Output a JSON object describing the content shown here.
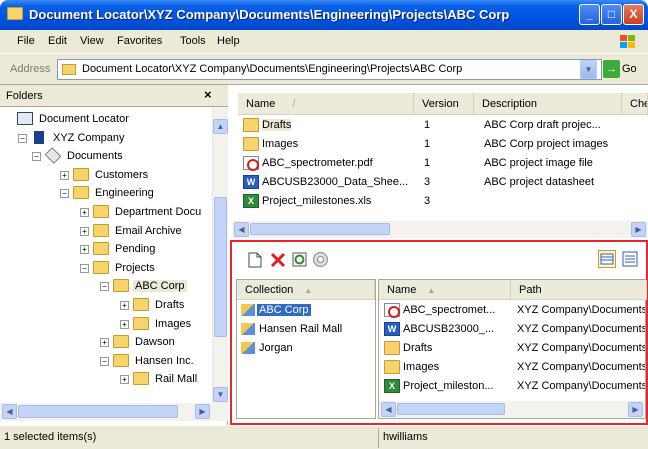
{
  "window": {
    "title": "Document Locator\\XYZ Company\\Documents\\Engineering\\Projects\\ABC Corp",
    "minimize": "_",
    "maximize": "□",
    "close": "X"
  },
  "menu": [
    "File",
    "Edit",
    "View",
    "Favorites",
    "Tools",
    "Help"
  ],
  "address": {
    "label": "Address",
    "value": "Document Locator\\XYZ Company\\Documents\\Engineering\\Projects\\ABC Corp",
    "go_label": "Go"
  },
  "folders": {
    "title": "Folders",
    "close": "×",
    "tree": [
      {
        "label": "Document Locator",
        "expander": "",
        "icon": "network-icon",
        "selected": false
      },
      {
        "label": "XYZ Company",
        "expander": "−",
        "icon": "company-icon",
        "selected": false
      },
      {
        "label": "Documents",
        "expander": "−",
        "icon": "documents-icon",
        "selected": false
      },
      {
        "label": "Customers",
        "expander": "+",
        "icon": "folder-icon",
        "selected": false
      },
      {
        "label": "Engineering",
        "expander": "−",
        "icon": "folder-icon",
        "selected": false
      },
      {
        "label": "Department Docu",
        "expander": "+",
        "icon": "folder-icon",
        "selected": false
      },
      {
        "label": "Email Archive",
        "expander": "+",
        "icon": "folder-icon",
        "selected": false
      },
      {
        "label": "Pending",
        "expander": "+",
        "icon": "folder-icon",
        "selected": false
      },
      {
        "label": "Projects",
        "expander": "−",
        "icon": "folder-icon",
        "selected": false
      },
      {
        "label": "ABC Corp",
        "expander": "−",
        "icon": "folder-open-icon",
        "selected": true
      },
      {
        "label": "Drafts",
        "expander": "+",
        "icon": "folder-icon",
        "selected": false
      },
      {
        "label": "Images",
        "expander": "+",
        "icon": "folder-icon",
        "selected": false
      },
      {
        "label": "Dawson",
        "expander": "+",
        "icon": "folder-icon",
        "selected": false
      },
      {
        "label": "Hansen Inc.",
        "expander": "−",
        "icon": "folder-icon",
        "selected": false
      },
      {
        "label": "Rail Mall",
        "expander": "+",
        "icon": "folder-icon",
        "selected": false
      }
    ]
  },
  "filelist": {
    "columns": {
      "name": "Name",
      "version": "Version",
      "description": "Description",
      "checked": "Chec"
    },
    "sort_glyph": "/",
    "rows": [
      {
        "icon": "folder-icon",
        "name": "Drafts",
        "version": "1",
        "description": "ABC Corp draft projec..."
      },
      {
        "icon": "folder-icon",
        "name": "Images",
        "version": "1",
        "description": "ABC Corp project images"
      },
      {
        "icon": "pdf-icon",
        "name": "ABC_spectrometer.pdf",
        "version": "1",
        "description": "ABC project image file"
      },
      {
        "icon": "word-doc-icon",
        "name": "ABCUSB23000_Data_Shee...",
        "version": "3",
        "description": "ABC project datasheet"
      },
      {
        "icon": "excel-icon",
        "name": "Project_milestones.xls",
        "version": "3",
        "description": ""
      }
    ]
  },
  "collections": {
    "toolbar_icons": [
      "new-collection-icon",
      "delete-icon",
      "refresh-icon",
      "settings-icon",
      "details-view-icon",
      "list-view-icon"
    ],
    "collection_header": "Collection",
    "collections": [
      "ABC Corp",
      "Hansen Rail Mall",
      "Jorgan"
    ],
    "items_header_name": "Name",
    "items_header_path": "Path",
    "items": [
      {
        "icon": "pdf-icon",
        "name": "ABC_spectromet...",
        "path": "XYZ Company\\Documents"
      },
      {
        "icon": "word-doc-icon",
        "name": "ABCUSB23000_...",
        "path": "XYZ Company\\Documents"
      },
      {
        "icon": "folder-icon",
        "name": "Drafts",
        "path": "XYZ Company\\Documents"
      },
      {
        "icon": "folder-icon",
        "name": "Images",
        "path": "XYZ Company\\Documents"
      },
      {
        "icon": "excel-icon",
        "name": "Project_mileston...",
        "path": "XYZ Company\\Documents"
      }
    ]
  },
  "status": {
    "selected": "1 selected items(s)",
    "user": "hwilliams"
  },
  "colors": {
    "accent": "#0054e3",
    "highlight_border": "#e8262d",
    "selection": "#316ac5"
  }
}
